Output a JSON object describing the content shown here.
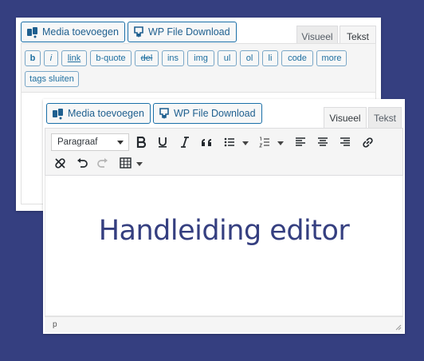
{
  "back_editor": {
    "media_button": "Media toevoegen",
    "download_button": "WP File Download",
    "tabs": [
      "Visueel",
      "Tekst"
    ],
    "active_tab": "Tekst",
    "quicktags": [
      "b",
      "i",
      "link",
      "b-quote",
      "del",
      "ins",
      "img",
      "ul",
      "ol",
      "li",
      "code",
      "more",
      "tags sluiten"
    ]
  },
  "front_editor": {
    "media_button": "Media toevoegen",
    "download_button": "WP File Download",
    "tabs": [
      "Visueel",
      "Tekst"
    ],
    "active_tab": "Visueel",
    "format_select": "Paragraaf",
    "toolbar_icons": [
      "bold-icon",
      "underline-icon",
      "italic-icon",
      "blockquote-icon",
      "bullet-list-icon",
      "numbered-list-icon",
      "align-left-icon",
      "align-center-icon",
      "align-right-icon",
      "insert-link-icon",
      "unlink-icon",
      "undo-icon",
      "redo-icon",
      "table-icon"
    ],
    "content_heading": "Handleiding editor",
    "status_path": "p"
  },
  "colors": {
    "background": "#353f80",
    "heading": "#353f80",
    "button_border": "#1a6fa8"
  }
}
